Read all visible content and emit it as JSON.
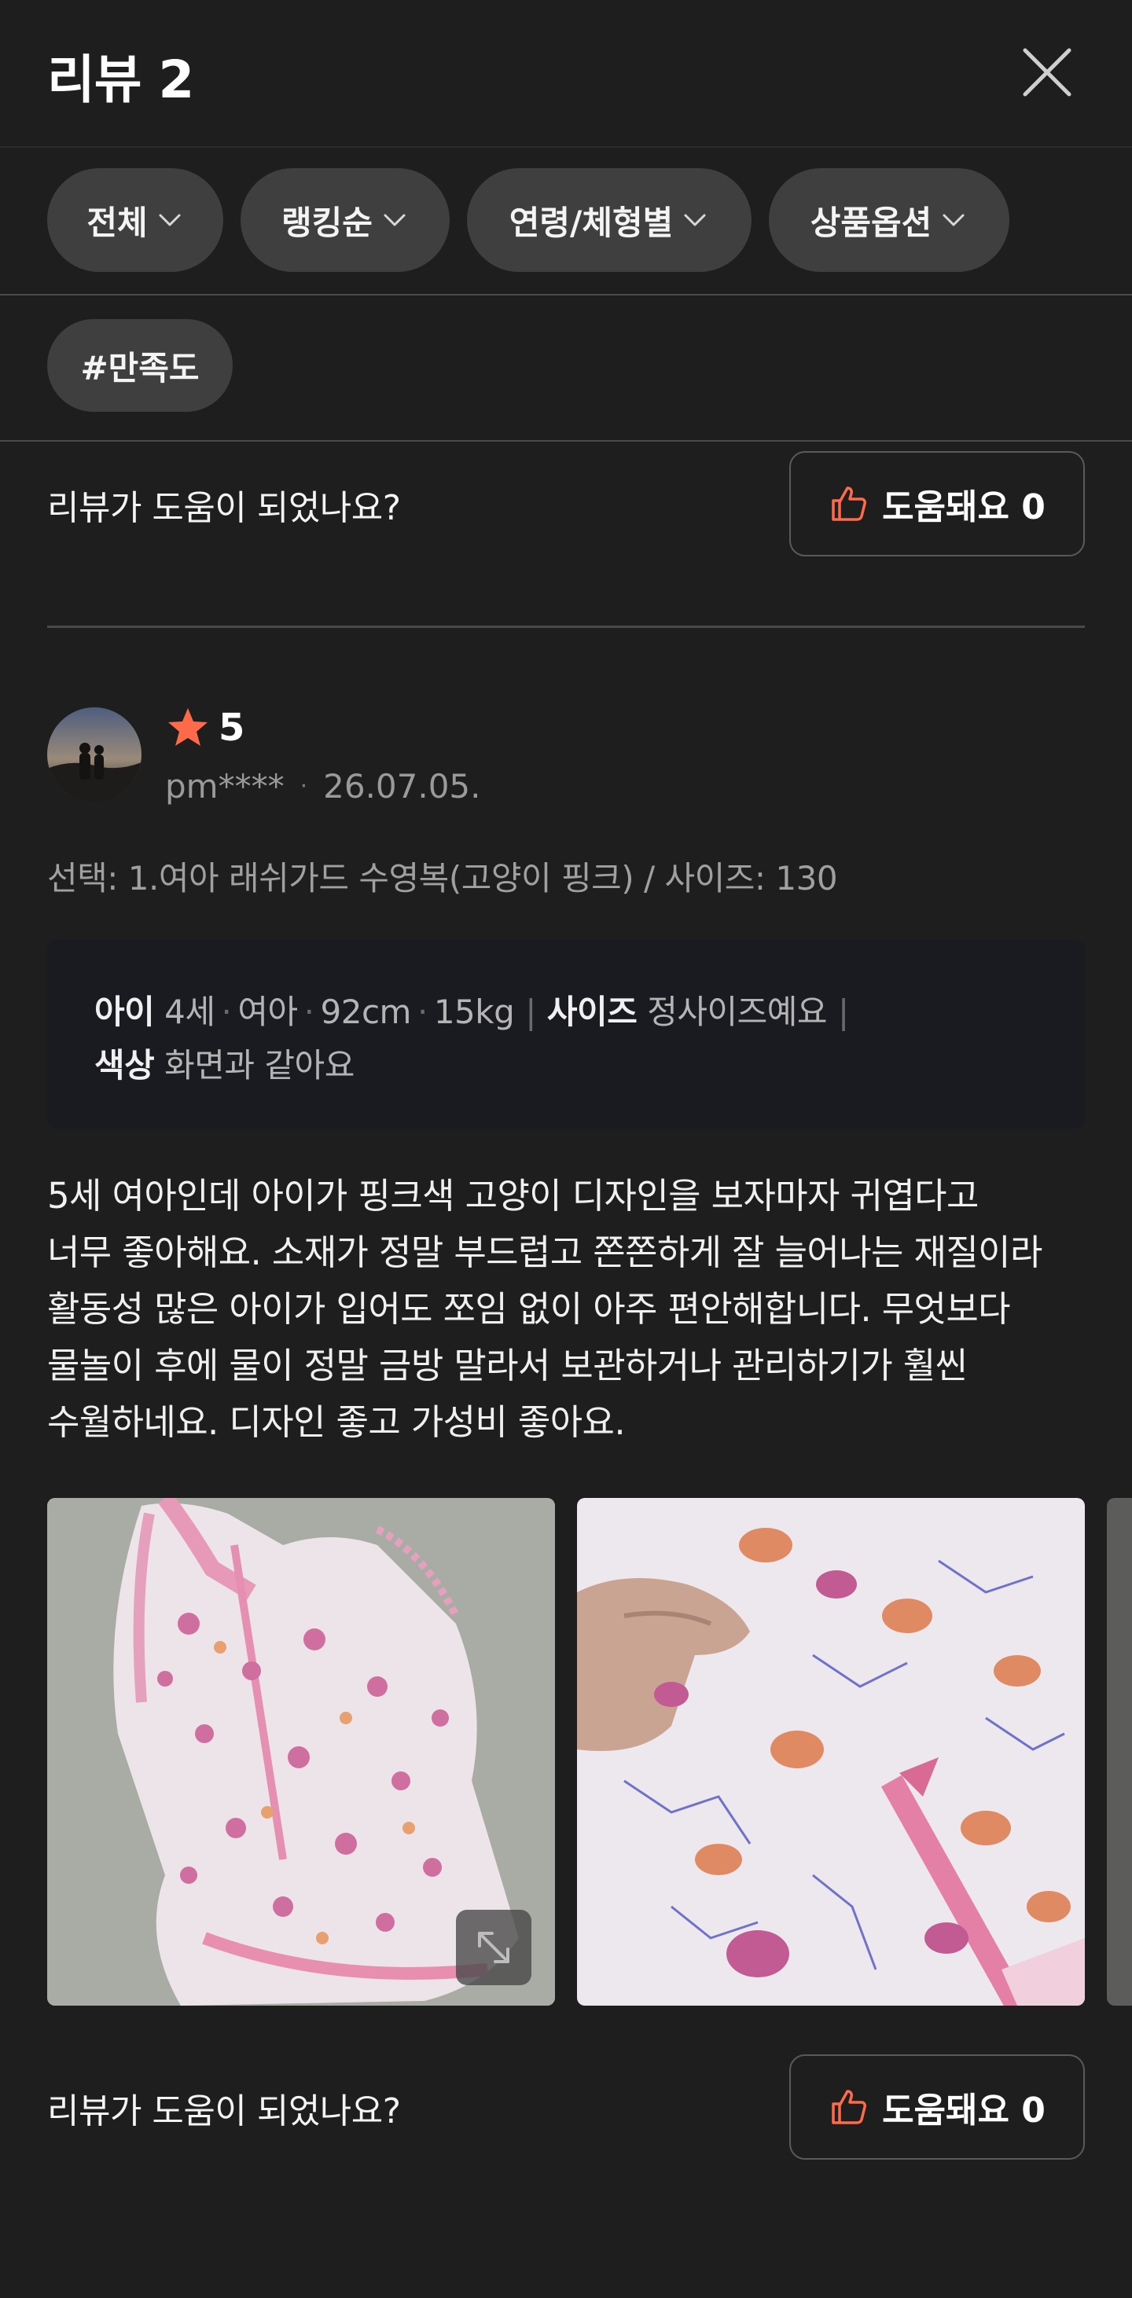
{
  "header": {
    "title": "리뷰 2"
  },
  "filters": [
    {
      "label": "전체"
    },
    {
      "label": "랭킹순"
    },
    {
      "label": "연령/체형별"
    },
    {
      "label": "상품옵션"
    }
  ],
  "tag": {
    "label": "#만족도"
  },
  "helpful_prev": {
    "question": "리뷰가 도움이 되었나요?",
    "button": "도움돼요 0"
  },
  "review": {
    "rating": "5",
    "user": "pm****",
    "date": "26.07.05.",
    "option": "선택: 1.여아 래쉬가드 수영복(고양이 핑크) / 사이즈: 130",
    "info": {
      "child_label": "아이",
      "age": "4세",
      "gender": "여아",
      "height": "92cm",
      "weight": "15kg",
      "size_label": "사이즈",
      "size_value": "정사이즈예요",
      "color_label": "색상",
      "color_value": "화면과 같아요"
    },
    "body_lines": [
      "5세 여아인데 아이가 핑크색 고양이 디자인을 보자마자 귀엽다고",
      "너무 좋아해요. 소재가 정말 부드럽고 쫀쫀하게 잘 늘어나는 재질이라",
      "활동성 많은 아이가 입어도 쪼임 없이 아주 편안해합니다. 무엇보다",
      "물놀이 후에 물이 정말 금방 말라서 보관하거나 관리하기가 훨씬",
      "수월하네요. 디자인 좋고 가성비 좋아요."
    ]
  },
  "helpful": {
    "question": "리뷰가 도움이 되었나요?",
    "button": "도움돼요 0"
  },
  "colors": {
    "background": "#1e1e1f",
    "chip": "#3f3f40",
    "accent_orange": "#ff6b4a",
    "info_box": "#1a1b21"
  },
  "icons": {
    "close": "close-icon",
    "chevron": "chevron-down-icon",
    "thumbs_up": "thumbs-up-icon",
    "star": "star-icon",
    "expand": "expand-icon"
  }
}
